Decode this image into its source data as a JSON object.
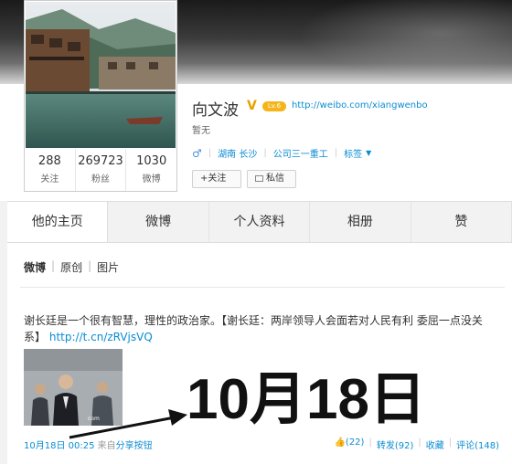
{
  "profile": {
    "name": "向文波",
    "verified_badge": "V",
    "level_badge": "Lv.6",
    "url": "http://weibo.com/xiangwenbo",
    "description": "暂无",
    "location": "湖南 长沙",
    "company": "公司三一重工",
    "tags_label": "标签",
    "follow_label": "+关注",
    "message_label": "私信",
    "stats": [
      {
        "value": "288",
        "label": "关注"
      },
      {
        "value": "269723",
        "label": "粉丝"
      },
      {
        "value": "1030",
        "label": "微博"
      }
    ]
  },
  "tabs": [
    "他的主页",
    "微博",
    "个人资料",
    "相册",
    "赞"
  ],
  "subtabs": [
    "微博",
    "原创",
    "图片"
  ],
  "post": {
    "text": "谢长廷是一个很有智慧，理性的政治家。【谢长廷：两岸领导人会面若对人民有利 委屈一点没关系】",
    "link": "http://t.cn/zRVjsVQ",
    "date": "10月18日",
    "time": "00:25",
    "source_prefix": "来自",
    "source": "分享按钮",
    "likes": "(22)",
    "repost": "转发(92)",
    "favorite": "收藏",
    "comments": "评论(148)"
  },
  "annotation": "10月18日",
  "colors": {
    "link": "#0a8cd2",
    "badge": "#f5b41a"
  }
}
